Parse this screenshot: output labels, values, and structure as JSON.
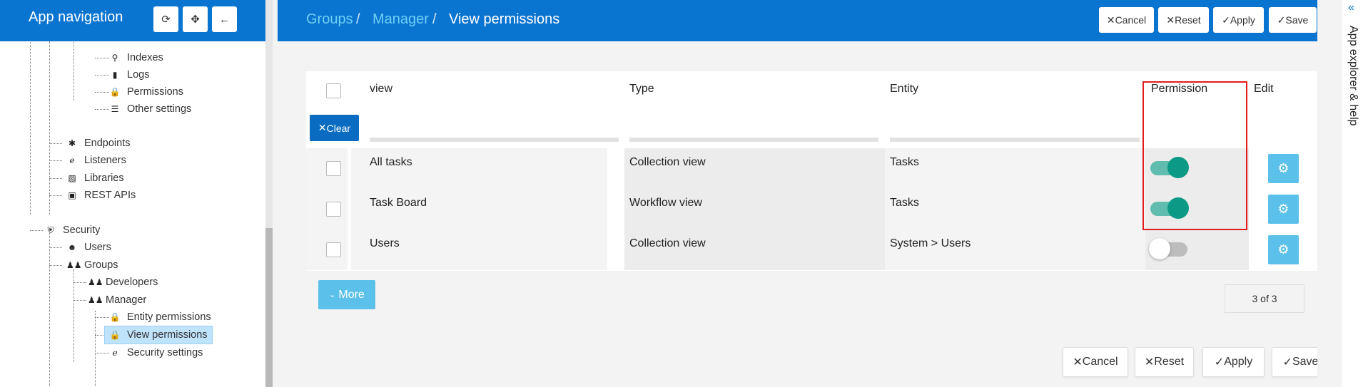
{
  "left_nav": {
    "title": "App navigation",
    "header_icons": [
      "refresh-icon",
      "crosshair-icon",
      "arrow-left-icon"
    ],
    "tree": [
      {
        "label": "Indexes",
        "icon": "search-icon"
      },
      {
        "label": "Logs",
        "icon": "bookmark-icon"
      },
      {
        "label": "Permissions",
        "icon": "lock-icon"
      },
      {
        "label": "Other settings",
        "icon": "list-icon"
      },
      {
        "label": "Endpoints",
        "icon": "puzzle-icon"
      },
      {
        "label": "Listeners",
        "icon": "ear-icon"
      },
      {
        "label": "Libraries",
        "icon": "box-icon"
      },
      {
        "label": "REST APIs",
        "icon": "api-icon"
      },
      {
        "label": "Security",
        "icon": "shield-icon"
      },
      {
        "label": "Users",
        "icon": "user-icon"
      },
      {
        "label": "Groups",
        "icon": "group-icon"
      },
      {
        "label": "Developers",
        "icon": "group-icon"
      },
      {
        "label": "Manager",
        "icon": "group-icon"
      },
      {
        "label": "Entity permissions",
        "icon": "lock-icon"
      },
      {
        "label": "View permissions",
        "icon": "lock-icon"
      },
      {
        "label": "Security settings",
        "icon": "ear-icon"
      }
    ],
    "selected": "View permissions"
  },
  "header": {
    "breadcrumb": [
      "Groups",
      "Manager",
      "View permissions"
    ],
    "separator": "/",
    "buttons": [
      "Cancel",
      "Reset",
      "Apply",
      "Save"
    ]
  },
  "table": {
    "columns": [
      "view",
      "Type",
      "Entity",
      "Permission",
      "Edit"
    ],
    "clear_label": "Clear",
    "rows": [
      {
        "view": "All tasks",
        "type": "Collection view",
        "entity": "Tasks",
        "permission": true
      },
      {
        "view": "Task Board",
        "type": "Workflow view",
        "entity": "Tasks",
        "permission": true
      },
      {
        "view": "Users",
        "type": "Collection view",
        "entity": "System > Users",
        "permission": false
      }
    ],
    "more_label": "More",
    "pager": "3 of 3"
  },
  "footer": {
    "buttons": [
      "Cancel",
      "Reset",
      "Apply",
      "Save"
    ]
  },
  "right_panel": {
    "label": "App explorer & help"
  },
  "colors": {
    "brand": "#0a74d1",
    "accent_link": "#6fd0f2",
    "toggle_on": "#0c9a86",
    "edit_button": "#5bc1ea",
    "highlight": "#e31b1b"
  }
}
